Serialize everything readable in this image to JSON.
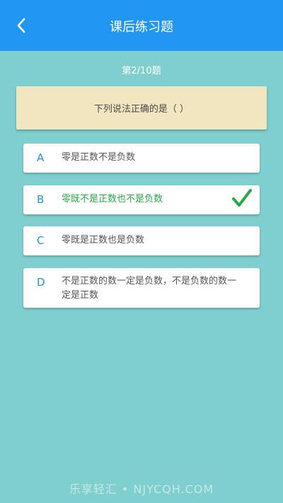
{
  "header": {
    "title": "课后练习题"
  },
  "progress": {
    "text": "第2/10题"
  },
  "question": {
    "text": "下列说法正确的是（    ）"
  },
  "options": [
    {
      "letter": "A",
      "text": "零是正数不是负数"
    },
    {
      "letter": "B",
      "text": "零既不是正数也不是负数"
    },
    {
      "letter": "C",
      "text": "零既是正数也是负数"
    },
    {
      "letter": "D",
      "text": "不是正数的数一定是负数，不是负数的数一定是正数"
    }
  ],
  "selected_option": "B",
  "icons": {
    "back": "chevron-left-icon",
    "correct": "check-icon"
  },
  "colors": {
    "header": "#2196f3",
    "background": "#7fcfcf",
    "question_card": "#f2e6c1",
    "letter": "#2196d3",
    "correct": "#2aa84a"
  },
  "watermark": "乐享轻汇 • NJYCQH.COM"
}
